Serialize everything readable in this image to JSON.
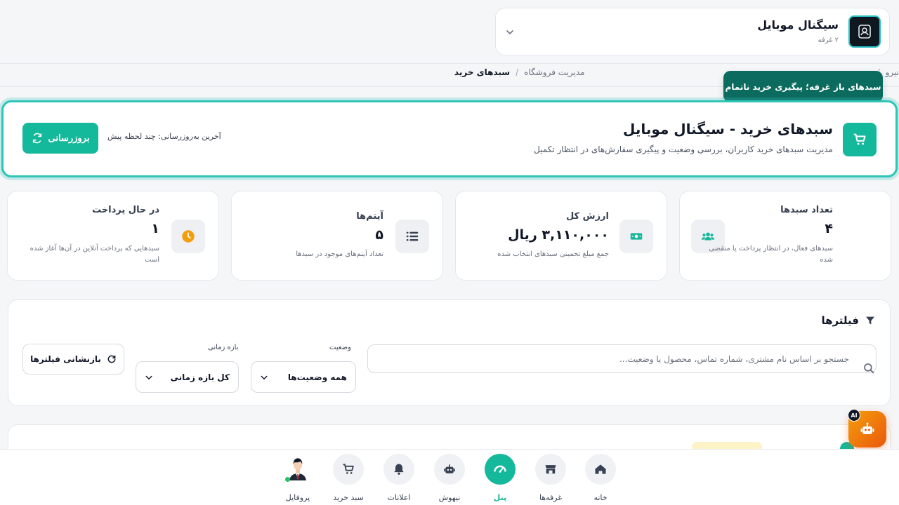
{
  "store": {
    "name": "سیگنال موبایل",
    "subtitle": "۲ غرفه"
  },
  "breadcrumb": {
    "items": [
      "نیرو",
      "مدیریت فروشگاه"
    ],
    "current": "سبدهای خرید"
  },
  "tooltip": "سبدهای باز غرفه؛ پیگیری خرید ناتمام",
  "header": {
    "title": "سبدهای خرید - سیگنال موبایل",
    "subtitle": "مدیریت سبدهای خرید کاربران، بررسی وضعیت و پیگیری سفارش‌های در انتظار تکمیل",
    "last_update": "آخرین به‌روزرسانی: چند لحظه پیش",
    "refresh_label": "بروزرسانی"
  },
  "stats": [
    {
      "label": "تعداد سبدها",
      "value": "۴",
      "desc": "سبدهای فعال، در انتظار پرداخت یا منقضی شده",
      "icon": "users-icon",
      "color": "#14b89a"
    },
    {
      "label": "ارزش کل",
      "value": "۳,۱۱۰,۰۰۰ ریال",
      "desc": "جمع مبلغ تخمینی سبدهای انتخاب شده",
      "icon": "money-icon",
      "color": "#14b89a"
    },
    {
      "label": "آیتم‌ها",
      "value": "۵",
      "desc": "تعداد آیتم‌های موجود در سبدها",
      "icon": "list-icon",
      "color": "#374151"
    },
    {
      "label": "در حال پرداخت",
      "value": "۱",
      "desc": "سبدهایی که پرداخت آنلاین در آن‌ها آغاز شده است",
      "icon": "clock-icon",
      "color": "#f59e0b"
    }
  ],
  "filters": {
    "title": "فیلترها",
    "search_placeholder": "جستجو بر اساس نام مشتری، شماره تماس، محصول یا وضعیت...",
    "status_label": "وضعیت",
    "status_value": "همه وضعیت‌ها",
    "period_label": "بازه زمانی",
    "period_value": "کل بازه زمانی",
    "reset_label": "بازنشانی فیلترها"
  },
  "ai_badge": "AI",
  "nav": {
    "items": [
      {
        "label": "خانه",
        "icon": "home-icon"
      },
      {
        "label": "غرفه‌ها",
        "icon": "store-icon"
      },
      {
        "label": "پنل",
        "icon": "dashboard-icon",
        "active": true
      },
      {
        "label": "نیهوش",
        "icon": "robot-icon"
      },
      {
        "label": "اعلانات",
        "icon": "bell-icon"
      },
      {
        "label": "سبد خرید",
        "icon": "cart-icon"
      },
      {
        "label": "پروفایل",
        "icon": "avatar"
      }
    ]
  },
  "colors": {
    "accent": "#14b89a",
    "highlight_border": "#2ec4b6",
    "tooltip_bg": "#0b6b5e",
    "ai_orange": "#ea580c"
  }
}
